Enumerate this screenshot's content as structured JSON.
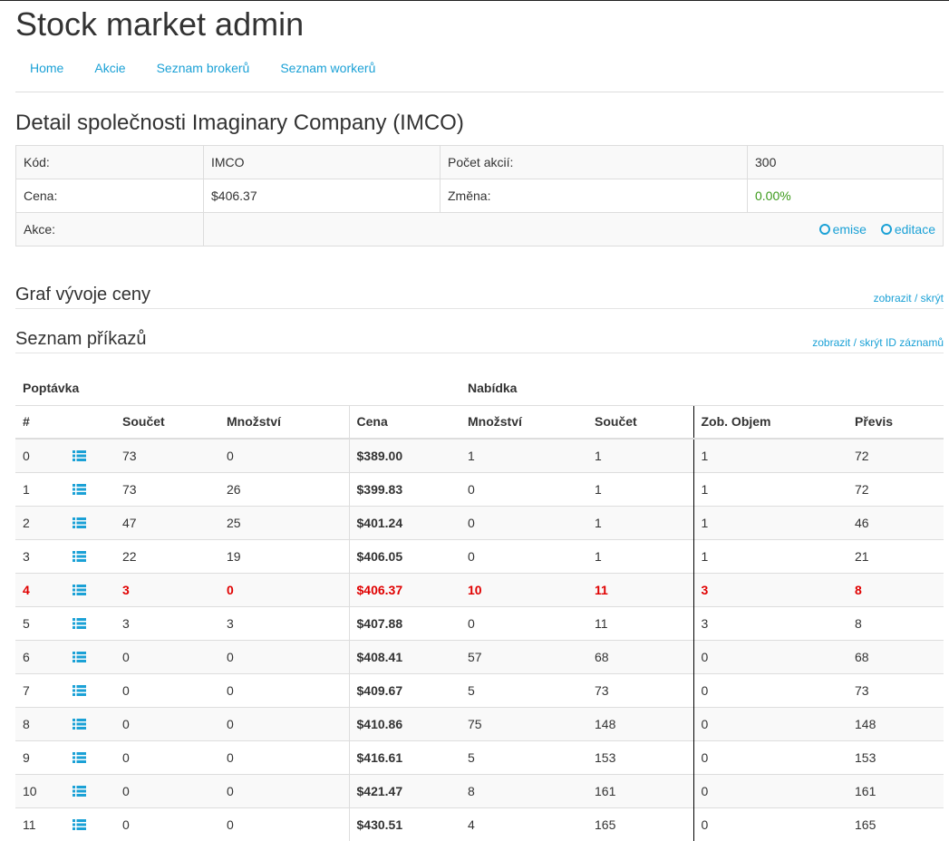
{
  "app_title": "Stock market admin",
  "nav": [
    "Home",
    "Akcie",
    "Seznam brokerů",
    "Seznam workerů"
  ],
  "page_title": "Detail společnosti Imaginary Company (IMCO)",
  "detail": {
    "kod_label": "Kód:",
    "kod_value": "IMCO",
    "pocet_label": "Počet akcií:",
    "pocet_value": "300",
    "cena_label": "Cena:",
    "cena_value": "$406.37",
    "zmena_label": "Změna:",
    "zmena_value": "0.00%",
    "akce_label": "Akce:",
    "emise_label": "emise",
    "editace_label": "editace"
  },
  "graf": {
    "title": "Graf vývoje ceny",
    "show": "zobrazit",
    "sep": " / ",
    "hide": "skrýt"
  },
  "prikazy": {
    "title": "Seznam příkazů",
    "show": "zobrazit",
    "sep": " / ",
    "hide": "skrýt ID záznamů"
  },
  "orders": {
    "group_left": "Poptávka",
    "group_right": "Nabídka",
    "columns": [
      "#",
      "",
      "Součet",
      "Množství",
      "Cena",
      "Množství",
      "Součet",
      "Zob. Objem",
      "Převis"
    ],
    "highlight_index": 4,
    "rows": [
      [
        "0",
        "73",
        "0",
        "$389.00",
        "1",
        "1",
        "1",
        "72"
      ],
      [
        "1",
        "73",
        "26",
        "$399.83",
        "0",
        "1",
        "1",
        "72"
      ],
      [
        "2",
        "47",
        "25",
        "$401.24",
        "0",
        "1",
        "1",
        "46"
      ],
      [
        "3",
        "22",
        "19",
        "$406.05",
        "0",
        "1",
        "1",
        "21"
      ],
      [
        "4",
        "3",
        "0",
        "$406.37",
        "10",
        "11",
        "3",
        "8"
      ],
      [
        "5",
        "3",
        "3",
        "$407.88",
        "0",
        "11",
        "3",
        "8"
      ],
      [
        "6",
        "0",
        "0",
        "$408.41",
        "57",
        "68",
        "0",
        "68"
      ],
      [
        "7",
        "0",
        "0",
        "$409.67",
        "5",
        "73",
        "0",
        "73"
      ],
      [
        "8",
        "0",
        "0",
        "$410.86",
        "75",
        "148",
        "0",
        "148"
      ],
      [
        "9",
        "0",
        "0",
        "$416.61",
        "5",
        "153",
        "0",
        "153"
      ],
      [
        "10",
        "0",
        "0",
        "$421.47",
        "8",
        "161",
        "0",
        "161"
      ],
      [
        "11",
        "0",
        "0",
        "$430.51",
        "4",
        "165",
        "0",
        "165"
      ]
    ]
  },
  "colors": {
    "link": "#1ba1d6",
    "highlight": "#e00000",
    "positive": "#3c9a1b"
  }
}
